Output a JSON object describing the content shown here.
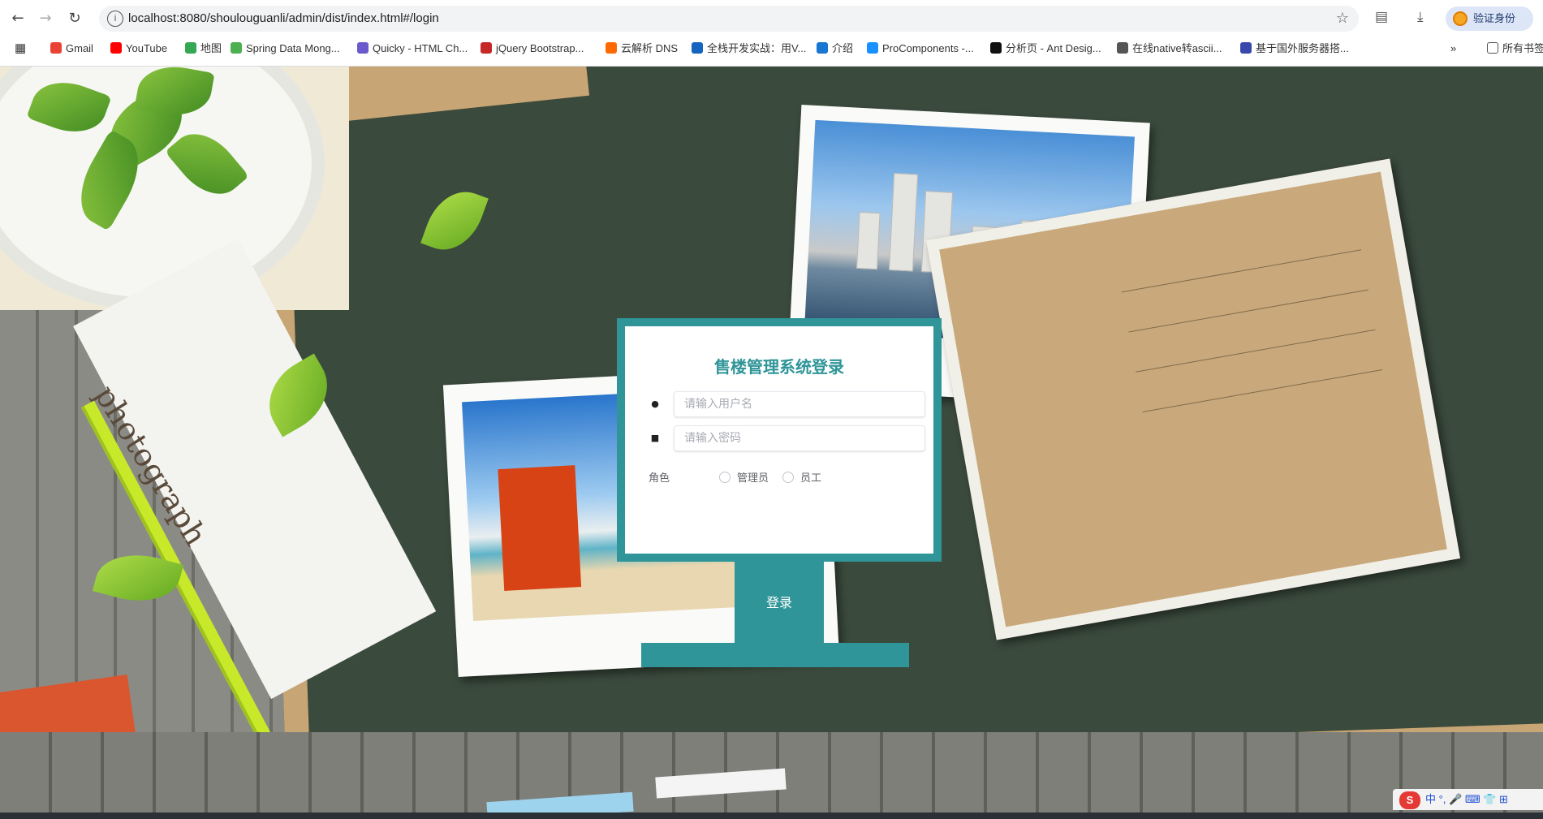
{
  "browser": {
    "url": "localhost:8080/shoulouguanli/admin/dist/index.html#/login",
    "verify_label": "验证身份",
    "all_bookmarks_label": "所有书签",
    "bookmarks": [
      {
        "label": "Gmail",
        "color": "#ea4335"
      },
      {
        "label": "YouTube",
        "color": "#ff0000"
      },
      {
        "label": "地图",
        "color": "#34a853"
      },
      {
        "label": "Spring Data Mong...",
        "color": "#4caf50"
      },
      {
        "label": "Quicky - HTML Ch...",
        "color": "#6a5acd"
      },
      {
        "label": "jQuery Bootstrap...",
        "color": "#c62828"
      },
      {
        "label": "云解析 DNS",
        "color": "#ff6a00"
      },
      {
        "label": "全栈开发实战：用V...",
        "color": "#1565c0"
      },
      {
        "label": "介绍",
        "color": "#1976d2"
      },
      {
        "label": "ProComponents -...",
        "color": "#1890ff"
      },
      {
        "label": "分析页 - Ant Desig...",
        "color": "#111111"
      },
      {
        "label": "在线native转ascii...",
        "color": "#555555"
      },
      {
        "label": "基于国外服务器搭...",
        "color": "#3949ab"
      }
    ]
  },
  "login": {
    "title": "售楼管理系统登录",
    "username_placeholder": "请输入用户名",
    "password_placeholder": "请输入密码",
    "role_label": "角色",
    "roles": [
      "管理员",
      "员工"
    ],
    "submit_label": "登录"
  },
  "scene": {
    "photo_word": "photograph",
    "ime_text": "中 °, 🎤 ⌨ 👕 ⊞"
  },
  "colors": {
    "accent": "#2f9598",
    "board": "#3a4a3c"
  }
}
